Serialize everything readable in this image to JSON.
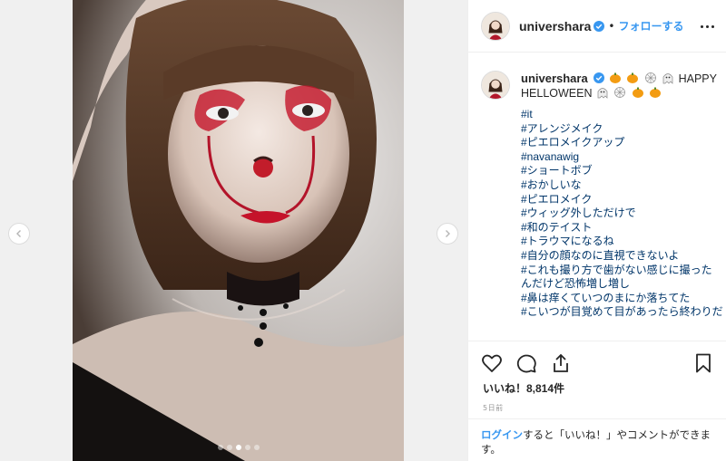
{
  "post": {
    "username": "univershara",
    "follow_label": "フォローする",
    "separator": "•",
    "caption_tail": "HAPPY HELLOWEEN",
    "hashtags": [
      "#it",
      "#アレンジメイク",
      "#ピエロメイクアップ",
      "#navanawig",
      "#ショートボブ",
      "#おかしいな",
      "#ピエロメイク",
      "#ウィッグ外しただけで",
      "#和のテイスト",
      "#トラウマになるね",
      "#自分の顔なのに直視できないよ",
      "#これも撮り方で歯がない感じに撮ったんだけど恐怖増し増し",
      "#鼻は痒くていつのまにか落ちてた",
      "#こいつが目覚めて目があったら終わりだ"
    ],
    "likes_text": "いいね！8,814件",
    "timestamp": "5日前",
    "login_link": "ログイン",
    "login_rest": "すると「いいね！」やコメントができます。"
  },
  "carousel": {
    "total_slides": 5,
    "active_index": 2
  },
  "icons": {
    "verified": "verified-badge-icon",
    "like": "heart-icon",
    "comment": "comment-bubble-icon",
    "share": "share-icon",
    "save": "bookmark-icon",
    "prev": "chevron-left-icon",
    "next": "chevron-right-icon",
    "more": "more-options-icon"
  },
  "colors": {
    "link": "#3897f0",
    "hashtag": "#003569",
    "text": "#262626",
    "muted": "#999999"
  }
}
